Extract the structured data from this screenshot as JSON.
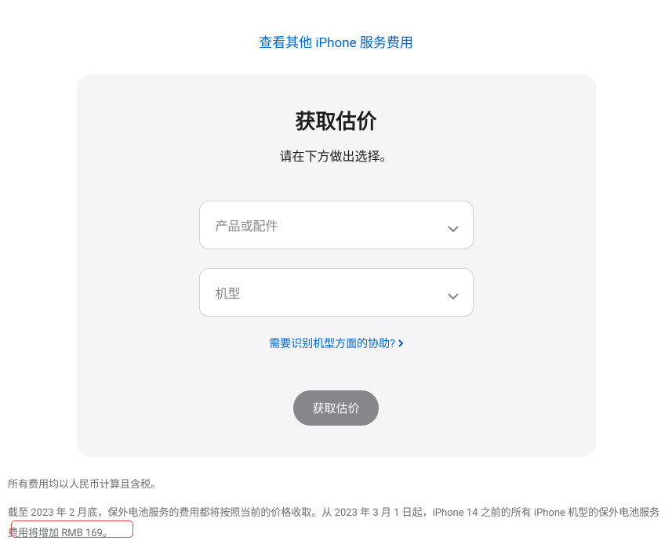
{
  "topLink": {
    "label": "查看其他 iPhone 服务费用"
  },
  "card": {
    "title": "获取估价",
    "subtitle": "请在下方做出选择。",
    "dropdown1": {
      "placeholder": "产品或配件"
    },
    "dropdown2": {
      "placeholder": "机型"
    },
    "helpLink": "需要识别机型方面的协助?",
    "submitLabel": "获取估价"
  },
  "footer": {
    "line1": "所有费用均以人民币计算且含税。",
    "line2": "截至 2023 年 2 月底，保外电池服务的费用都将按照当前的价格收取。从 2023 年 3 月 1 日起，iPhone 14 之前的所有 iPhone 机型的保外电池服务费用将增加 RMB 169。"
  }
}
